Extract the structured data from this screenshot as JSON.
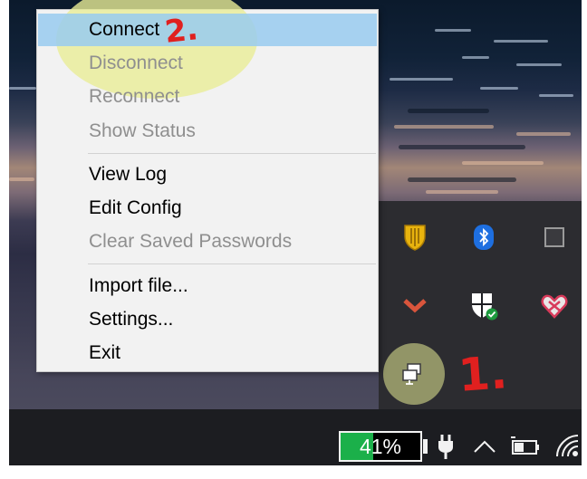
{
  "context_menu": {
    "items": [
      {
        "label": "Connect",
        "enabled": true,
        "selected": true
      },
      {
        "label": "Disconnect",
        "enabled": false
      },
      {
        "label": "Reconnect",
        "enabled": false
      },
      {
        "label": "Show Status",
        "enabled": false
      },
      {
        "label": "View Log",
        "enabled": true
      },
      {
        "label": "Edit Config",
        "enabled": true
      },
      {
        "label": "Clear Saved Passwords",
        "enabled": false
      },
      {
        "label": "Import file...",
        "enabled": true
      },
      {
        "label": "Settings...",
        "enabled": true
      },
      {
        "label": "Exit",
        "enabled": true
      }
    ]
  },
  "annotations": {
    "step_1": "1.",
    "step_2": "2."
  },
  "tray_overflow": {
    "icons": [
      "shield-app-icon",
      "bluetooth-icon",
      "square-app-icon",
      "chevron-app-icon",
      "windows-security-icon",
      "heart-app-icon",
      "openvpn-icon"
    ]
  },
  "taskbar": {
    "battery_text": "41%",
    "battery_level": 0.41,
    "icons": [
      "power-plug-icon",
      "show-hidden-icons-chevron",
      "battery-icon",
      "wifi-icon"
    ]
  },
  "colors": {
    "selection": "#99cbf0",
    "highlight_circle": "#e8ec96",
    "annotation_red": "#e0201f",
    "battery_green": "#1bb04a",
    "taskbar": "#1c1d21"
  }
}
